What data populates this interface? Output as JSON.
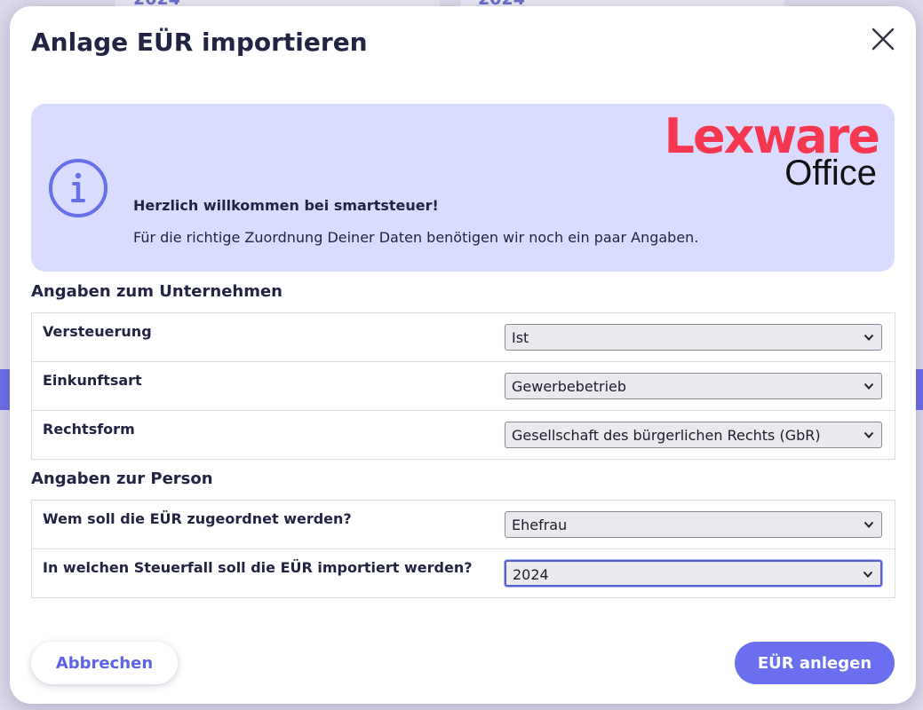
{
  "modal": {
    "title": "Anlage EÜR importieren"
  },
  "info": {
    "heading": "Herzlich willkommen bei smartsteuer!",
    "text": "Für die richtige Zuordnung Deiner Daten benötigen wir noch ein paar Angaben.",
    "logo_top": "Lexware",
    "logo_bottom": "Office"
  },
  "company": {
    "title": "Angaben zum Unternehmen",
    "fields": [
      {
        "label": "Versteuerung",
        "value": "Ist"
      },
      {
        "label": "Einkunftsart",
        "value": "Gewerbebetrieb"
      },
      {
        "label": "Rechtsform",
        "value": "Gesellschaft des bürgerlichen Rechts (GbR)"
      }
    ]
  },
  "person": {
    "title": "Angaben zur Person",
    "fields": [
      {
        "label": "Wem soll die EÜR zugeordnet werden?",
        "value": "Ehefrau"
      },
      {
        "label": "In welchen Steuerfall soll die EÜR importiert werden?",
        "value": "2024"
      }
    ]
  },
  "buttons": {
    "cancel": "Abbrechen",
    "submit": "EÜR anlegen"
  },
  "background": {
    "year_left": "2024",
    "year_right": "2024"
  },
  "colors": {
    "accent": "#6a6ff0",
    "info_bg": "#d9dcff",
    "logo_red": "#f5374f"
  }
}
